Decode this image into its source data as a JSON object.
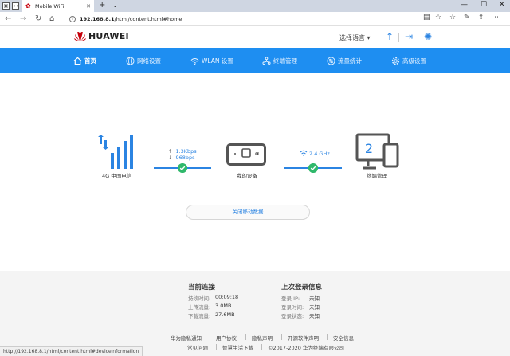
{
  "browser": {
    "tab_title": "Mobile WiFi",
    "url_host": "192.168.8.1",
    "url_path": "/html/content.html#home",
    "status_url": "http://192.168.8.1/html/content.html#deviceinformation"
  },
  "header": {
    "brand": "HUAWEI",
    "language": "选择语言"
  },
  "menu": {
    "items": [
      {
        "label": "首页",
        "icon": "home-icon"
      },
      {
        "label": "网络设置",
        "icon": "globe-icon"
      },
      {
        "label": "WLAN 设置",
        "icon": "wifi-icon"
      },
      {
        "label": "终端管理",
        "icon": "devices-icon"
      },
      {
        "label": "流量统计",
        "icon": "traffic-icon"
      },
      {
        "label": "高级设置",
        "icon": "gear-icon"
      }
    ]
  },
  "status": {
    "network_label": "4G  中国电信",
    "upload_speed": "1.3Kbps",
    "download_speed": "968bps",
    "device_label": "我的设备",
    "wifi_band": "2.4 GHz",
    "terminal_count": "2",
    "terminal_label": "终端管理",
    "mobile_data_button": "关闭移动数据"
  },
  "current_connection": {
    "title": "当前连接",
    "rows": [
      {
        "key": "持续时间:",
        "value": "00:09:18"
      },
      {
        "key": "上传流量:",
        "value": "3.0MB"
      },
      {
        "key": "下载流量:",
        "value": "27.6MB"
      }
    ]
  },
  "last_login": {
    "title": "上次登录信息",
    "rows": [
      {
        "key": "登录 IP:",
        "value": "未知"
      },
      {
        "key": "登录时间:",
        "value": "未知"
      },
      {
        "key": "登录状态:",
        "value": "未知"
      }
    ]
  },
  "footer_links": {
    "row1": [
      "华为隐私通知",
      "用户协议",
      "隐私声明",
      "开源软件声明",
      "安全信息"
    ],
    "row2": [
      "常见问题",
      "智慧生活下载",
      "©2017-2020 华为终端有限公司"
    ]
  },
  "colors": {
    "accent": "#1e8ef1",
    "link": "#2b84e2",
    "ok": "#2fb86b",
    "brand_red": "#c7000b"
  }
}
